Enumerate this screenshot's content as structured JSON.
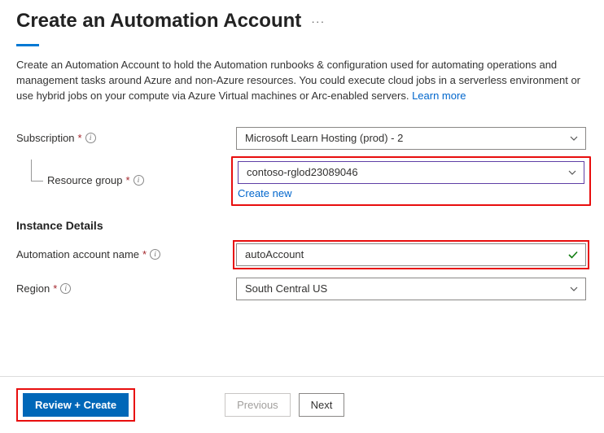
{
  "header": {
    "title": "Create an Automation Account"
  },
  "description": {
    "text": "Create an Automation Account to hold the Automation runbooks & configuration used for automating operations and management tasks around Azure and non-Azure resources. You could execute cloud jobs in a serverless environment or use hybrid jobs on your compute via Azure Virtual machines or Arc-enabled servers. ",
    "learn_more": "Learn more"
  },
  "fields": {
    "subscription": {
      "label": "Subscription",
      "value": "Microsoft Learn Hosting (prod) - 2"
    },
    "resource_group": {
      "label": "Resource group",
      "value": "contoso-rglod23089046",
      "create_new": "Create new"
    },
    "instance_heading": "Instance Details",
    "account_name": {
      "label": "Automation account name",
      "value": "autoAccount"
    },
    "region": {
      "label": "Region",
      "value": "South Central US"
    }
  },
  "footer": {
    "review_create": "Review + Create",
    "previous": "Previous",
    "next": "Next"
  }
}
